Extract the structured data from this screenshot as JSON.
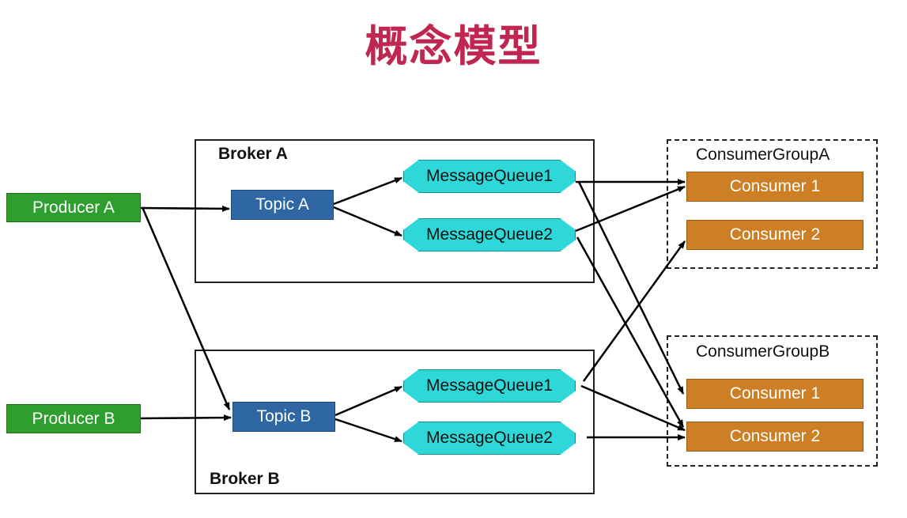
{
  "title": "概念模型",
  "brokers": [
    {
      "label": "Broker A",
      "topic": "Topic A",
      "queues": [
        "MessageQueue1",
        "MessageQueue2"
      ]
    },
    {
      "label": "Broker B",
      "topic": "Topic B",
      "queues": [
        "MessageQueue1",
        "MessageQueue2"
      ]
    }
  ],
  "producers": [
    "Producer A",
    "Producer B"
  ],
  "consumer_groups": [
    {
      "label": "ConsumerGroupA",
      "consumers": [
        "Consumer 1",
        "Consumer 2"
      ]
    },
    {
      "label": "ConsumerGroupB",
      "consumers": [
        "Consumer 1",
        "Consumer 2"
      ]
    }
  ],
  "colors": {
    "title": "#c0264f",
    "producer": "#2e9e2e",
    "topic": "#2f67a4",
    "queue": "#2fd8d8",
    "consumer": "#cc7f24",
    "arrow": "#000000"
  }
}
